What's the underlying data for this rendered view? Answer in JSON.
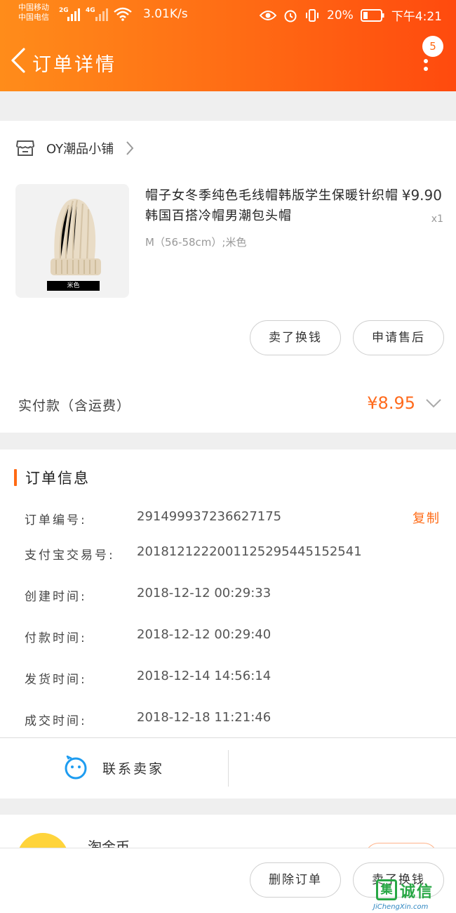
{
  "status_bar": {
    "carrier1": "中国移动",
    "carrier2": "中国电信",
    "net1": "2G",
    "net2": "4G",
    "speed": "3.01K/s",
    "battery": "20%",
    "time": "下午4:21"
  },
  "header": {
    "title": "订单详情",
    "badge_count": "5"
  },
  "shop": {
    "name": "OY潮品小铺"
  },
  "product": {
    "title": "帽子女冬季纯色毛线帽韩版学生保暖针织帽韩国百搭冷帽男潮包头帽",
    "price": "¥9.90",
    "quantity": "x1",
    "sku": "M（56-58cm）;米色",
    "image_tag": "米色"
  },
  "actions": {
    "sell_button": "卖了换钱",
    "after_sale_button": "申请售后"
  },
  "payment": {
    "label": "实付款（含运费）",
    "amount": "¥8.95"
  },
  "order_info": {
    "section_title": "订单信息",
    "copy_label": "复制",
    "rows": [
      {
        "label": "订单编号:",
        "value": "291499937236627175"
      },
      {
        "label": "支付宝交易号:",
        "value": "2018121222001125295445152541"
      },
      {
        "label": "创建时间:",
        "value": "2018-12-12 00:29:33"
      },
      {
        "label": "付款时间:",
        "value": "2018-12-12 00:29:40"
      },
      {
        "label": "发货时间:",
        "value": "2018-12-14 14:56:14"
      },
      {
        "label": "成交时间:",
        "value": "2018-12-18 11:21:46"
      }
    ]
  },
  "contact": {
    "label": "联系卖家"
  },
  "recommend": {
    "title": "淘金币"
  },
  "bottom_bar": {
    "delete_button": "删除订单",
    "sell_button": "卖了换钱"
  },
  "watermark": {
    "logo_char": "集",
    "cn": "诚信",
    "en": "JiChengXin.com"
  },
  "colors": {
    "accent": "#ff6a14",
    "price_highlight": "#ff6a1c"
  }
}
